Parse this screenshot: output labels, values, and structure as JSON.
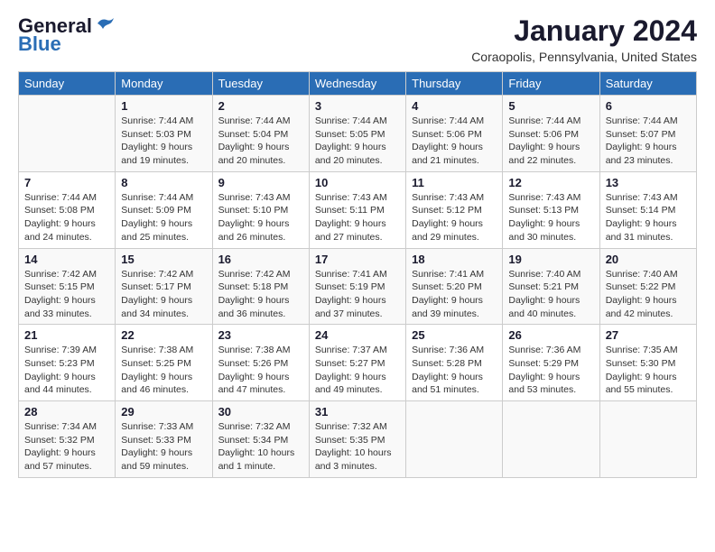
{
  "logo": {
    "line1": "General",
    "line2": "Blue"
  },
  "title": "January 2024",
  "location": "Coraopolis, Pennsylvania, United States",
  "weekdays": [
    "Sunday",
    "Monday",
    "Tuesday",
    "Wednesday",
    "Thursday",
    "Friday",
    "Saturday"
  ],
  "weeks": [
    [
      {
        "day": "",
        "sunrise": "",
        "sunset": "",
        "daylight": ""
      },
      {
        "day": "1",
        "sunrise": "Sunrise: 7:44 AM",
        "sunset": "Sunset: 5:03 PM",
        "daylight": "Daylight: 9 hours and 19 minutes."
      },
      {
        "day": "2",
        "sunrise": "Sunrise: 7:44 AM",
        "sunset": "Sunset: 5:04 PM",
        "daylight": "Daylight: 9 hours and 20 minutes."
      },
      {
        "day": "3",
        "sunrise": "Sunrise: 7:44 AM",
        "sunset": "Sunset: 5:05 PM",
        "daylight": "Daylight: 9 hours and 20 minutes."
      },
      {
        "day": "4",
        "sunrise": "Sunrise: 7:44 AM",
        "sunset": "Sunset: 5:06 PM",
        "daylight": "Daylight: 9 hours and 21 minutes."
      },
      {
        "day": "5",
        "sunrise": "Sunrise: 7:44 AM",
        "sunset": "Sunset: 5:06 PM",
        "daylight": "Daylight: 9 hours and 22 minutes."
      },
      {
        "day": "6",
        "sunrise": "Sunrise: 7:44 AM",
        "sunset": "Sunset: 5:07 PM",
        "daylight": "Daylight: 9 hours and 23 minutes."
      }
    ],
    [
      {
        "day": "7",
        "sunrise": "Sunrise: 7:44 AM",
        "sunset": "Sunset: 5:08 PM",
        "daylight": "Daylight: 9 hours and 24 minutes."
      },
      {
        "day": "8",
        "sunrise": "Sunrise: 7:44 AM",
        "sunset": "Sunset: 5:09 PM",
        "daylight": "Daylight: 9 hours and 25 minutes."
      },
      {
        "day": "9",
        "sunrise": "Sunrise: 7:43 AM",
        "sunset": "Sunset: 5:10 PM",
        "daylight": "Daylight: 9 hours and 26 minutes."
      },
      {
        "day": "10",
        "sunrise": "Sunrise: 7:43 AM",
        "sunset": "Sunset: 5:11 PM",
        "daylight": "Daylight: 9 hours and 27 minutes."
      },
      {
        "day": "11",
        "sunrise": "Sunrise: 7:43 AM",
        "sunset": "Sunset: 5:12 PM",
        "daylight": "Daylight: 9 hours and 29 minutes."
      },
      {
        "day": "12",
        "sunrise": "Sunrise: 7:43 AM",
        "sunset": "Sunset: 5:13 PM",
        "daylight": "Daylight: 9 hours and 30 minutes."
      },
      {
        "day": "13",
        "sunrise": "Sunrise: 7:43 AM",
        "sunset": "Sunset: 5:14 PM",
        "daylight": "Daylight: 9 hours and 31 minutes."
      }
    ],
    [
      {
        "day": "14",
        "sunrise": "Sunrise: 7:42 AM",
        "sunset": "Sunset: 5:15 PM",
        "daylight": "Daylight: 9 hours and 33 minutes."
      },
      {
        "day": "15",
        "sunrise": "Sunrise: 7:42 AM",
        "sunset": "Sunset: 5:17 PM",
        "daylight": "Daylight: 9 hours and 34 minutes."
      },
      {
        "day": "16",
        "sunrise": "Sunrise: 7:42 AM",
        "sunset": "Sunset: 5:18 PM",
        "daylight": "Daylight: 9 hours and 36 minutes."
      },
      {
        "day": "17",
        "sunrise": "Sunrise: 7:41 AM",
        "sunset": "Sunset: 5:19 PM",
        "daylight": "Daylight: 9 hours and 37 minutes."
      },
      {
        "day": "18",
        "sunrise": "Sunrise: 7:41 AM",
        "sunset": "Sunset: 5:20 PM",
        "daylight": "Daylight: 9 hours and 39 minutes."
      },
      {
        "day": "19",
        "sunrise": "Sunrise: 7:40 AM",
        "sunset": "Sunset: 5:21 PM",
        "daylight": "Daylight: 9 hours and 40 minutes."
      },
      {
        "day": "20",
        "sunrise": "Sunrise: 7:40 AM",
        "sunset": "Sunset: 5:22 PM",
        "daylight": "Daylight: 9 hours and 42 minutes."
      }
    ],
    [
      {
        "day": "21",
        "sunrise": "Sunrise: 7:39 AM",
        "sunset": "Sunset: 5:23 PM",
        "daylight": "Daylight: 9 hours and 44 minutes."
      },
      {
        "day": "22",
        "sunrise": "Sunrise: 7:38 AM",
        "sunset": "Sunset: 5:25 PM",
        "daylight": "Daylight: 9 hours and 46 minutes."
      },
      {
        "day": "23",
        "sunrise": "Sunrise: 7:38 AM",
        "sunset": "Sunset: 5:26 PM",
        "daylight": "Daylight: 9 hours and 47 minutes."
      },
      {
        "day": "24",
        "sunrise": "Sunrise: 7:37 AM",
        "sunset": "Sunset: 5:27 PM",
        "daylight": "Daylight: 9 hours and 49 minutes."
      },
      {
        "day": "25",
        "sunrise": "Sunrise: 7:36 AM",
        "sunset": "Sunset: 5:28 PM",
        "daylight": "Daylight: 9 hours and 51 minutes."
      },
      {
        "day": "26",
        "sunrise": "Sunrise: 7:36 AM",
        "sunset": "Sunset: 5:29 PM",
        "daylight": "Daylight: 9 hours and 53 minutes."
      },
      {
        "day": "27",
        "sunrise": "Sunrise: 7:35 AM",
        "sunset": "Sunset: 5:30 PM",
        "daylight": "Daylight: 9 hours and 55 minutes."
      }
    ],
    [
      {
        "day": "28",
        "sunrise": "Sunrise: 7:34 AM",
        "sunset": "Sunset: 5:32 PM",
        "daylight": "Daylight: 9 hours and 57 minutes."
      },
      {
        "day": "29",
        "sunrise": "Sunrise: 7:33 AM",
        "sunset": "Sunset: 5:33 PM",
        "daylight": "Daylight: 9 hours and 59 minutes."
      },
      {
        "day": "30",
        "sunrise": "Sunrise: 7:32 AM",
        "sunset": "Sunset: 5:34 PM",
        "daylight": "Daylight: 10 hours and 1 minute."
      },
      {
        "day": "31",
        "sunrise": "Sunrise: 7:32 AM",
        "sunset": "Sunset: 5:35 PM",
        "daylight": "Daylight: 10 hours and 3 minutes."
      },
      {
        "day": "",
        "sunrise": "",
        "sunset": "",
        "daylight": ""
      },
      {
        "day": "",
        "sunrise": "",
        "sunset": "",
        "daylight": ""
      },
      {
        "day": "",
        "sunrise": "",
        "sunset": "",
        "daylight": ""
      }
    ]
  ]
}
